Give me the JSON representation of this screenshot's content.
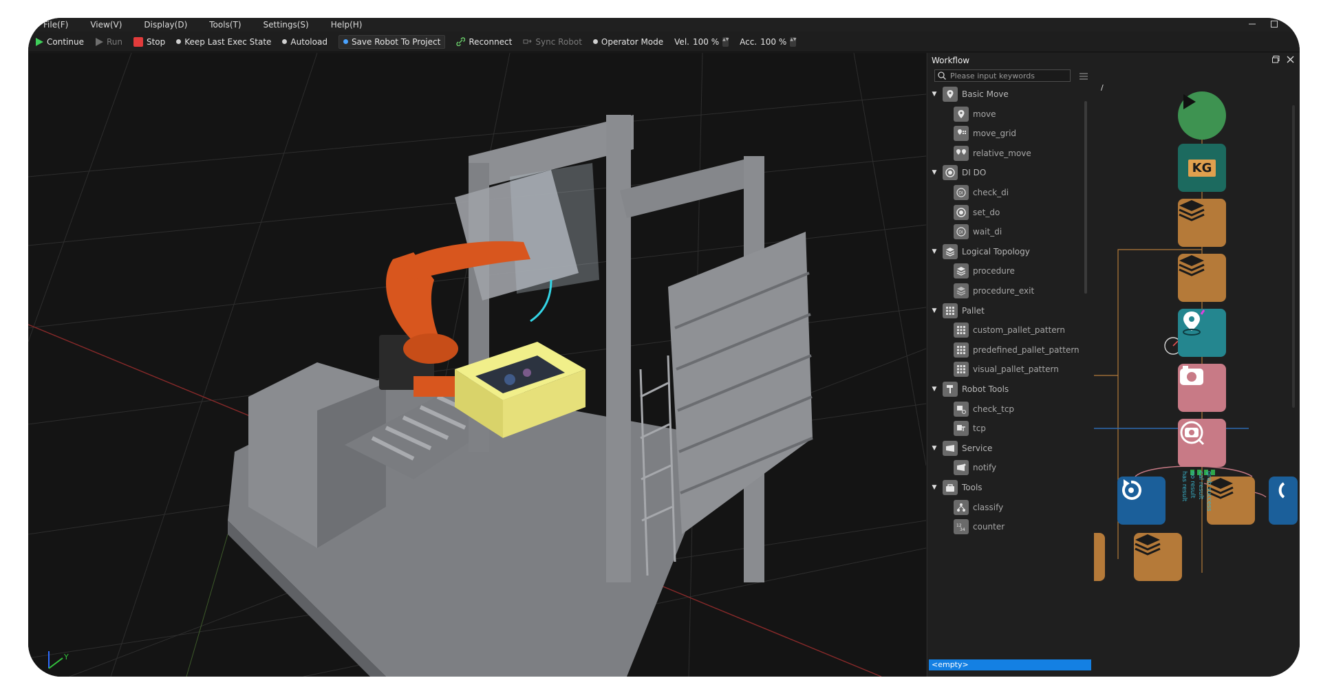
{
  "menu": [
    "File(F)",
    "View(V)",
    "Display(D)",
    "Tools(T)",
    "Settings(S)",
    "Help(H)"
  ],
  "toolbar": {
    "continue": "Continue",
    "run": "Run",
    "stop": "Stop",
    "keep_last": "Keep Last Exec State",
    "autoload": "Autoload",
    "save_robot": "Save Robot To Project",
    "reconnect": "Reconnect",
    "sync_robot": "Sync Robot",
    "operator_mode": "Operator Mode",
    "vel_label": "Vel.",
    "vel_value": "100 %",
    "acc_label": "Acc.",
    "acc_value": "100 %"
  },
  "viewport": {
    "axis_y": "Y"
  },
  "workflow": {
    "title": "Workflow",
    "search_placeholder": "Please input keywords",
    "path": "/",
    "empty_label": "<empty>",
    "tree": [
      {
        "type": "category",
        "label": "Basic Move",
        "icon": "pin-icon"
      },
      {
        "type": "item",
        "label": "move",
        "icon": "pin-icon"
      },
      {
        "type": "item",
        "label": "move_grid",
        "icon": "grid-pin-icon"
      },
      {
        "type": "item",
        "label": "relative_move",
        "icon": "double-pin-icon"
      },
      {
        "type": "category",
        "label": "DI DO",
        "icon": "circle-icon"
      },
      {
        "type": "item",
        "label": "check_di",
        "icon": "di-icon"
      },
      {
        "type": "item",
        "label": "set_do",
        "icon": "circle-icon"
      },
      {
        "type": "item",
        "label": "wait_di",
        "icon": "di-icon"
      },
      {
        "type": "category",
        "label": "Logical Topology",
        "icon": "layers-icon"
      },
      {
        "type": "item",
        "label": "procedure",
        "icon": "layers-icon"
      },
      {
        "type": "item",
        "label": "procedure_exit",
        "icon": "layers-exit-icon"
      },
      {
        "type": "category",
        "label": "Pallet",
        "icon": "pallet-icon"
      },
      {
        "type": "item",
        "label": "custom_pallet_pattern",
        "icon": "pallet-icon"
      },
      {
        "type": "item",
        "label": "predefined_pallet_pattern",
        "icon": "pallet-icon"
      },
      {
        "type": "item",
        "label": "visual_pallet_pattern",
        "icon": "pallet-icon"
      },
      {
        "type": "category",
        "label": "Robot Tools",
        "icon": "hammer-icon"
      },
      {
        "type": "item",
        "label": "check_tcp",
        "icon": "tcp-check-icon"
      },
      {
        "type": "item",
        "label": "tcp",
        "icon": "tcp-icon"
      },
      {
        "type": "category",
        "label": "Service",
        "icon": "service-icon"
      },
      {
        "type": "item",
        "label": "notify",
        "icon": "notify-icon"
      },
      {
        "type": "category",
        "label": "Tools",
        "icon": "toolbox-icon"
      },
      {
        "type": "item",
        "label": "classify",
        "icon": "classify-icon"
      },
      {
        "type": "item",
        "label": "counter",
        "icon": "counter-icon"
      }
    ],
    "nodes": {
      "kg_label": "KG"
    },
    "side_notes": [
      "has result",
      "no result",
      "cal result",
      "grab success"
    ]
  },
  "colors": {
    "accent_blue": "#1480e3",
    "robot_orange": "#d8561e",
    "node_teal": "#1c6a5f",
    "node_brown": "#b57a39",
    "node_pink": "#c87a86",
    "node_cyan": "#24868f",
    "node_blue": "#1b5f9a",
    "start_green": "#3e9351",
    "stop_red": "#e23b3b"
  }
}
